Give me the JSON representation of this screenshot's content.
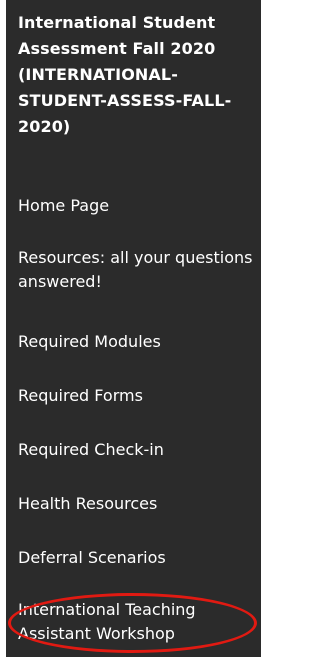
{
  "course": {
    "title": "International Student Assessment Fall 2020 (INTERNATIONAL-STUDENT-ASSESS-FALL-2020)"
  },
  "nav": {
    "items": [
      {
        "label": "Home Page"
      },
      {
        "label": "Resources: all your questions answered!"
      },
      {
        "label": "Required Modules"
      },
      {
        "label": "Required Forms"
      },
      {
        "label": "Required Check-in"
      },
      {
        "label": "Health Resources"
      },
      {
        "label": "Deferral Scenarios"
      },
      {
        "label": "International Teaching Assistant Workshop"
      }
    ]
  },
  "annotation": {
    "color": "#e11a12"
  }
}
